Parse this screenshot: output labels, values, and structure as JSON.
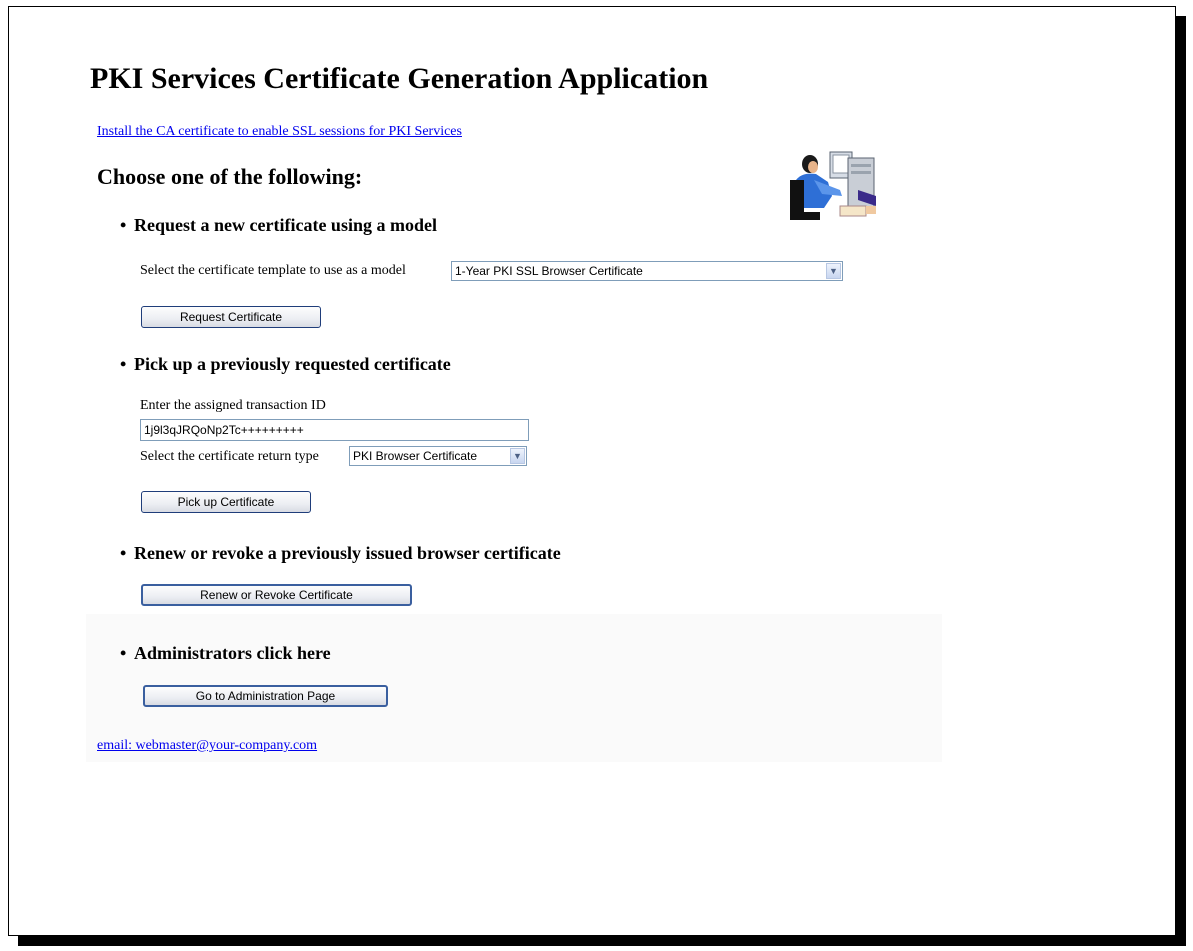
{
  "page": {
    "title": "PKI Services Certificate Generation Application",
    "ca_link": "Install the CA certificate to enable SSL sessions for PKI Services",
    "choose_heading": "Choose one of the following:",
    "clipart_icon": "person-at-computer-icon"
  },
  "sections": {
    "request": {
      "heading": "Request a new certificate using a model",
      "template_label": "Select the certificate template to use as a model",
      "template_selected": "1-Year PKI SSL Browser Certificate",
      "button_label": "Request Certificate"
    },
    "pickup": {
      "heading": "Pick up a previously requested certificate",
      "txid_label": "Enter the assigned transaction ID",
      "txid_value": "1j9l3qJRQoNp2Tc+++++++++",
      "return_type_label": "Select the certificate return type",
      "return_type_selected": "PKI Browser Certificate",
      "button_label": "Pick up Certificate"
    },
    "renew": {
      "heading": "Renew or revoke a previously issued browser certificate",
      "button_label": "Renew or Revoke Certificate"
    },
    "admin": {
      "heading": "Administrators click here",
      "button_label": "Go to Administration Page"
    }
  },
  "footer": {
    "email_link": "email: webmaster@your-company.com"
  },
  "colors": {
    "link": "#0000ee",
    "button_border": "#1f3d7a",
    "frame_shadow": "#000000"
  }
}
